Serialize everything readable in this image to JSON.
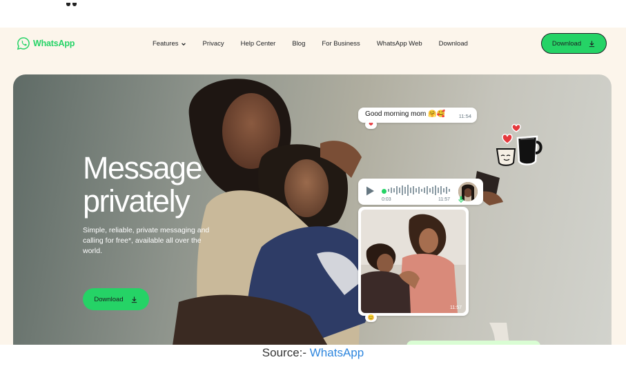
{
  "nav": {
    "logo_text": "WhatsApp",
    "links": [
      "Features",
      "Privacy",
      "Help Center",
      "Blog",
      "For Business",
      "WhatsApp Web",
      "Download"
    ],
    "download_label": "Download"
  },
  "hero": {
    "title_line1": "Message",
    "title_line2": "privately",
    "subtitle": "Simple, reliable, private messaging and calling for free*, available all over the world.",
    "download_label": "Download"
  },
  "chat": {
    "message_text": "Good morning mom 🤗🥰",
    "message_time": "11:54",
    "message_reaction": "❤",
    "voice_duration": "0:03",
    "voice_time": "11:57",
    "photo_time": "11:57",
    "photo_reaction": "😊"
  },
  "caption": {
    "prefix": "Source:- ",
    "link": "WhatsApp"
  },
  "colors": {
    "brand_green": "#25d366",
    "page_bg": "#fcf5eb",
    "text_dark": "#1c1e21",
    "link_blue": "#2e86de"
  },
  "icons": [
    "whatsapp-logo-icon",
    "chevron-down-icon",
    "download-icon",
    "play-icon",
    "mic-icon",
    "heart-icon",
    "coffee-mugs-sticker"
  ]
}
